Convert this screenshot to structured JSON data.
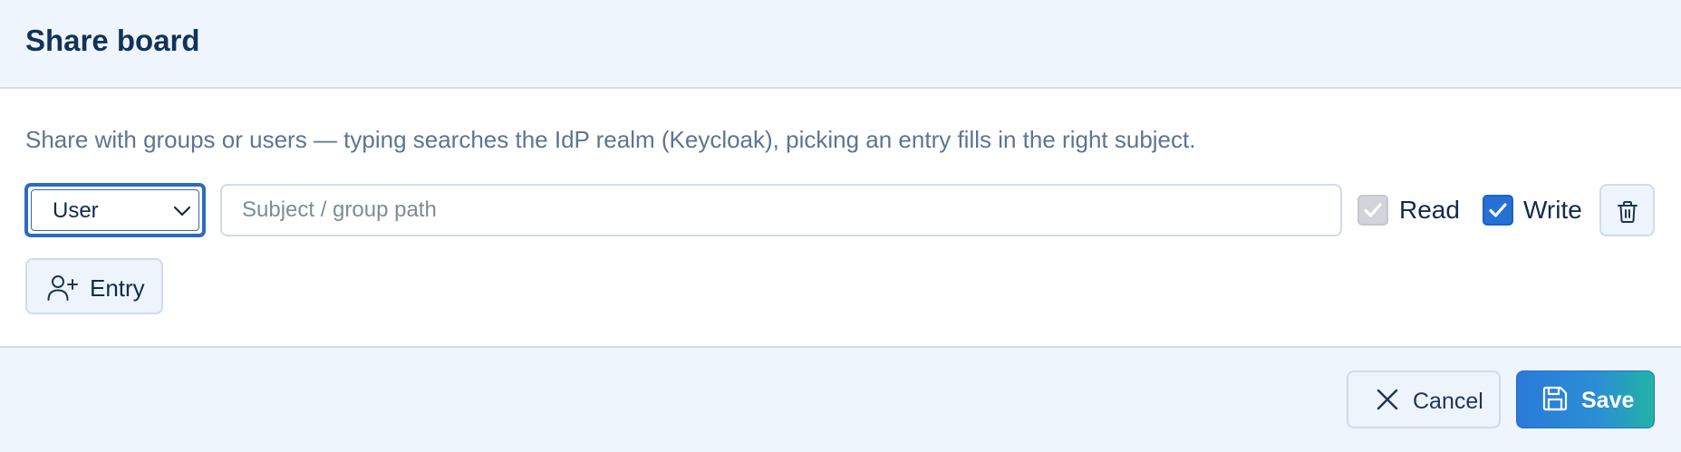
{
  "dialog": {
    "title": "Share board",
    "description": "Share with groups or users — typing searches the IdP realm (Keycloak), picking an entry fills in the right subject."
  },
  "entry_row": {
    "type_select": {
      "selected": "User",
      "icon": "chevron-down-icon"
    },
    "subject_input": {
      "value": "",
      "placeholder": "Subject / group path"
    },
    "read": {
      "label": "Read",
      "checked": true,
      "disabled": true
    },
    "write": {
      "label": "Write",
      "checked": true,
      "disabled": false
    },
    "delete_icon": "trash-icon"
  },
  "add_entry_button": {
    "label": "Entry",
    "icon": "user-plus-icon"
  },
  "footer": {
    "cancel": {
      "label": "Cancel",
      "icon": "close-icon"
    },
    "save": {
      "label": "Save",
      "icon": "floppy-disk-icon"
    }
  },
  "colors": {
    "accent": "#2570d4",
    "save_gradient_start": "#2a7ad9",
    "save_gradient_end": "#21b3a5",
    "header_bg": "#eff5fc",
    "text_primary": "#0f2b4f",
    "text_muted": "#5c7593"
  }
}
